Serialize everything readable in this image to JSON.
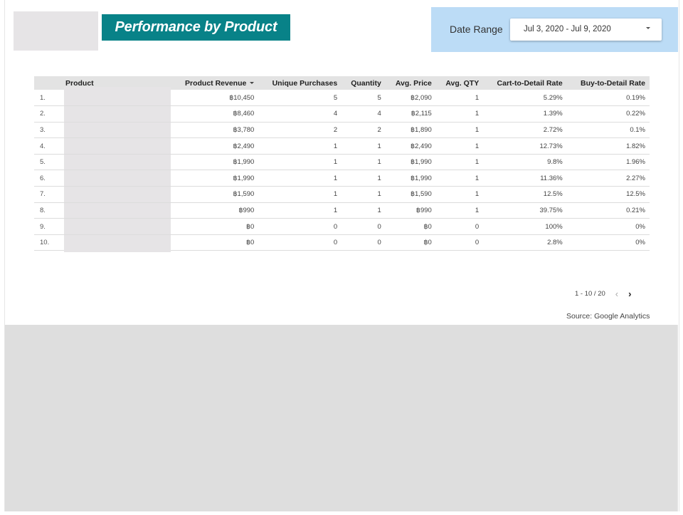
{
  "header": {
    "title": "Performance by Product",
    "date_range_label": "Date Range",
    "date_range_value": "Jul 3, 2020 - Jul 9, 2020"
  },
  "table": {
    "columns": [
      "Product",
      "Product Revenue",
      "Unique Purchases",
      "Quantity",
      "Avg. Price",
      "Avg. QTY",
      "Cart-to-Detail Rate",
      "Buy-to-Detail Rate"
    ],
    "sorted_column": "Product Revenue",
    "rows": [
      {
        "idx": "1.",
        "revenue": "฿10,450",
        "unique": "5",
        "qty": "5",
        "avg_price": "฿2,090",
        "avg_qty": "1",
        "cart": "5.29%",
        "buy": "0.19%"
      },
      {
        "idx": "2.",
        "revenue": "฿8,460",
        "unique": "4",
        "qty": "4",
        "avg_price": "฿2,115",
        "avg_qty": "1",
        "cart": "1.39%",
        "buy": "0.22%"
      },
      {
        "idx": "3.",
        "revenue": "฿3,780",
        "unique": "2",
        "qty": "2",
        "avg_price": "฿1,890",
        "avg_qty": "1",
        "cart": "2.72%",
        "buy": "0.1%"
      },
      {
        "idx": "4.",
        "revenue": "฿2,490",
        "unique": "1",
        "qty": "1",
        "avg_price": "฿2,490",
        "avg_qty": "1",
        "cart": "12.73%",
        "buy": "1.82%"
      },
      {
        "idx": "5.",
        "revenue": "฿1,990",
        "unique": "1",
        "qty": "1",
        "avg_price": "฿1,990",
        "avg_qty": "1",
        "cart": "9.8%",
        "buy": "1.96%"
      },
      {
        "idx": "6.",
        "revenue": "฿1,990",
        "unique": "1",
        "qty": "1",
        "avg_price": "฿1,990",
        "avg_qty": "1",
        "cart": "11.36%",
        "buy": "2.27%"
      },
      {
        "idx": "7.",
        "revenue": "฿1,590",
        "unique": "1",
        "qty": "1",
        "avg_price": "฿1,590",
        "avg_qty": "1",
        "cart": "12.5%",
        "buy": "12.5%"
      },
      {
        "idx": "8.",
        "revenue": "฿990",
        "unique": "1",
        "qty": "1",
        "avg_price": "฿990",
        "avg_qty": "1",
        "cart": "39.75%",
        "buy": "0.21%"
      },
      {
        "idx": "9.",
        "revenue": "฿0",
        "unique": "0",
        "qty": "0",
        "avg_price": "฿0",
        "avg_qty": "0",
        "cart": "100%",
        "buy": "0%"
      },
      {
        "idx": "10.",
        "revenue": "฿0",
        "unique": "0",
        "qty": "0",
        "avg_price": "฿0",
        "avg_qty": "0",
        "cart": "2.8%",
        "buy": "0%"
      }
    ]
  },
  "pagination": {
    "range": "1 - 10 / 20",
    "prev_icon": "‹",
    "next_icon": "›"
  },
  "footer": {
    "source": "Source: Google Analytics"
  },
  "colors": {
    "title_bg": "#088288",
    "date_panel_bg": "#bcdcf6"
  }
}
